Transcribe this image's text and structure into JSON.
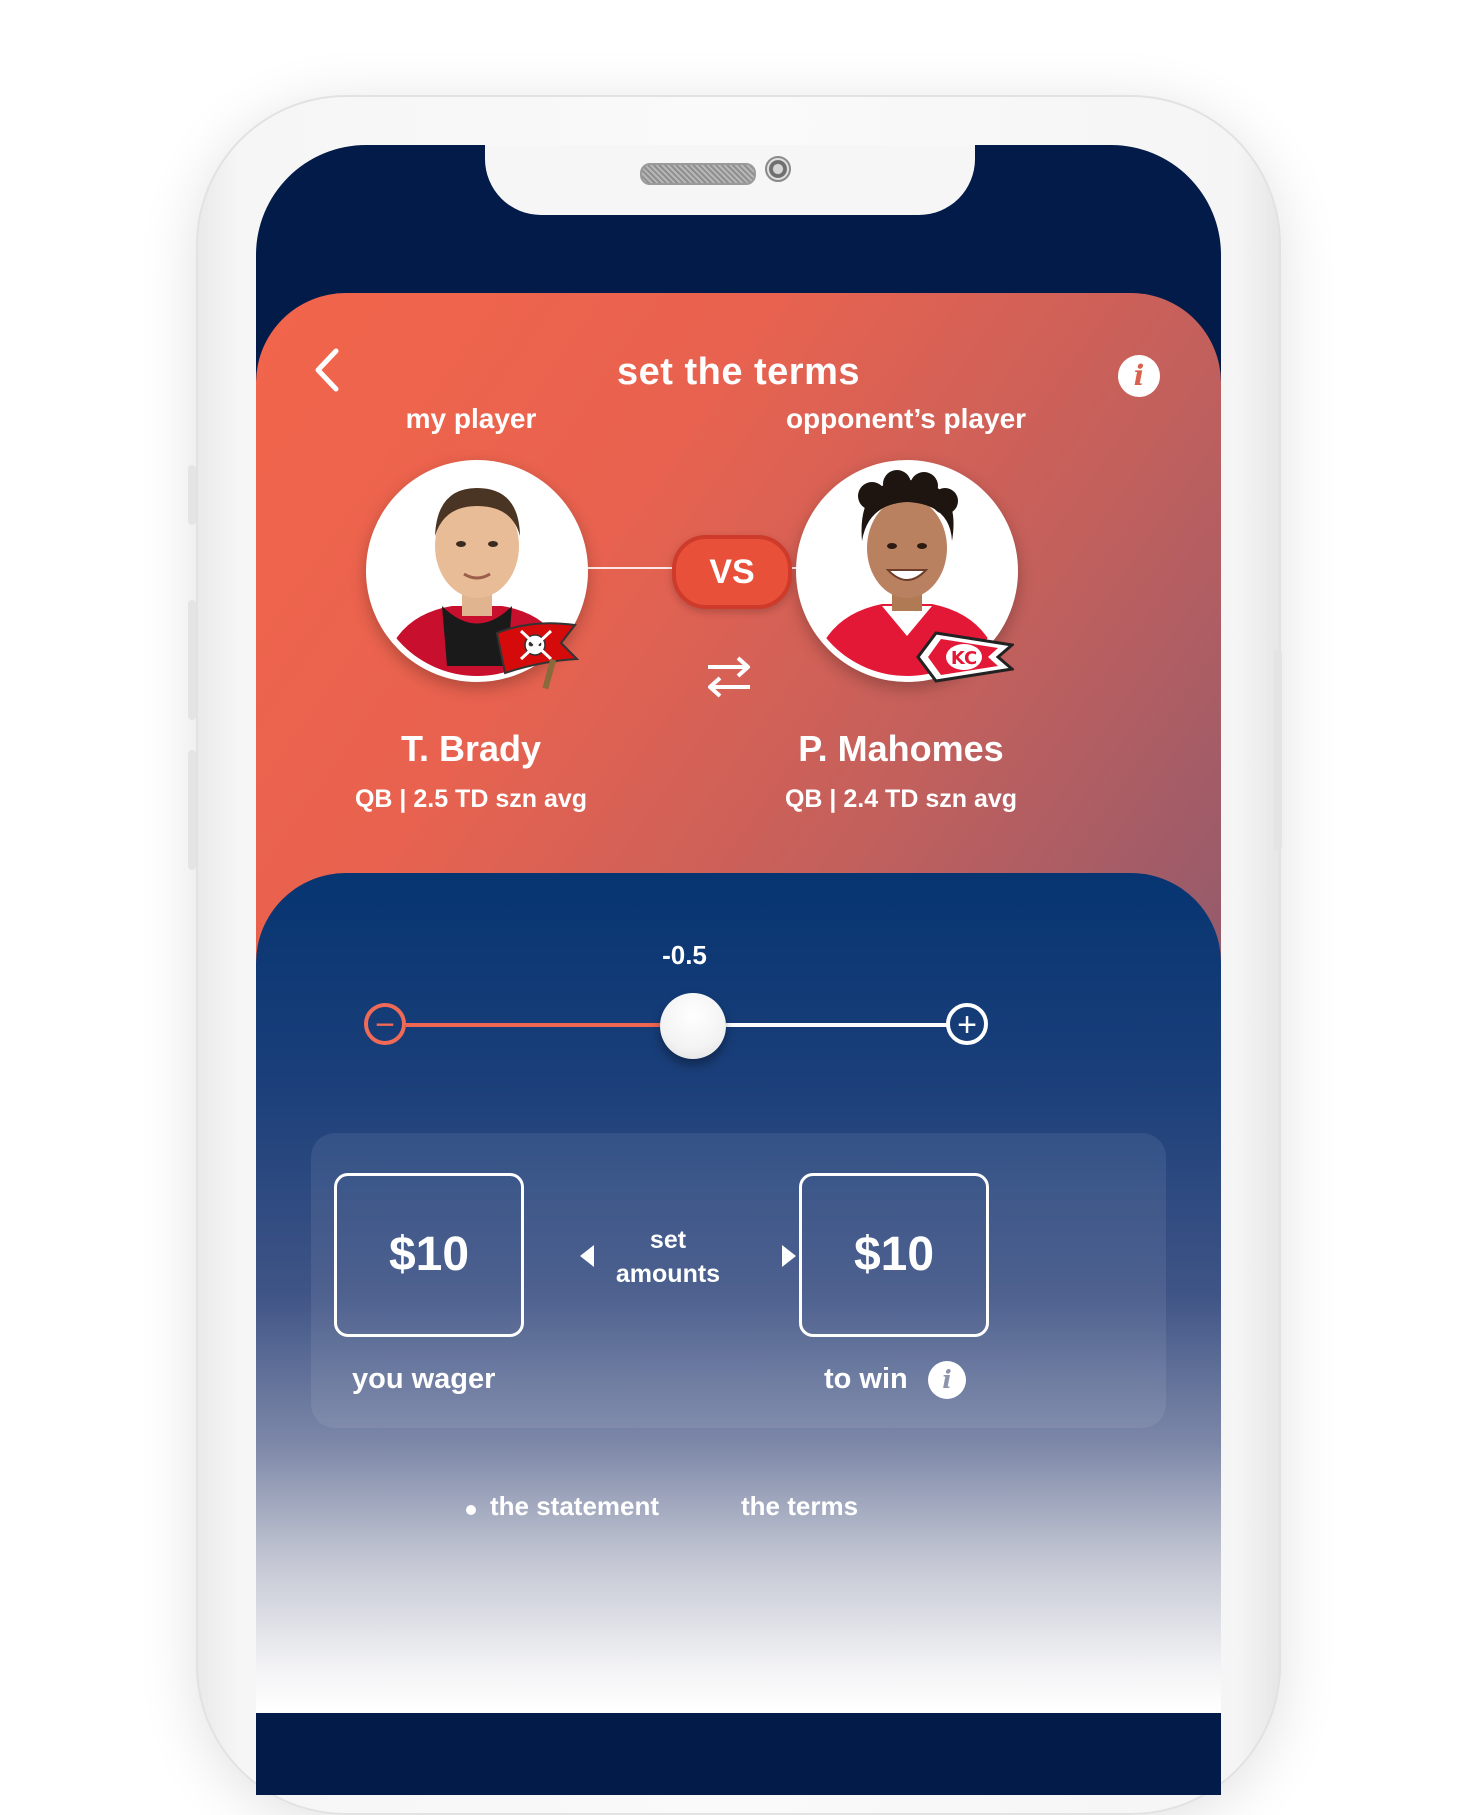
{
  "header": {
    "title": "set the terms",
    "back_icon": "chevron-left-icon",
    "info_icon": "info-icon",
    "info_glyph": "i"
  },
  "matchup": {
    "my_player_label": "my player",
    "opponent_player_label": "opponent’s player",
    "vs_label": "VS",
    "swap_icon": "swap-arrows-icon",
    "my_player": {
      "name": "T. Brady",
      "stat": "QB | 2.5 TD szn avg",
      "team_logo": "buccaneers-flag-logo",
      "jersey_color": "#c8102e"
    },
    "opponent_player": {
      "name": "P. Mahomes",
      "stat": "QB | 2.4 TD szn avg",
      "team_logo": "chiefs-arrowhead-logo",
      "jersey_color": "#e31837"
    }
  },
  "spread_slider": {
    "value": "-0.5",
    "minus_glyph": "−",
    "plus_glyph": "+",
    "position_fraction": 0.5
  },
  "amounts": {
    "wager_value": "$10",
    "wager_label": "you wager",
    "center_line1": "set",
    "center_line2": "amounts",
    "win_value": "$10",
    "win_label": "to win",
    "info_glyph": "i"
  },
  "steps": {
    "statement_label": "the statement",
    "terms_label": "the terms"
  },
  "colors": {
    "accent_orange": "#f2654b",
    "navy": "#031b48",
    "vs_red": "#e8503a"
  }
}
